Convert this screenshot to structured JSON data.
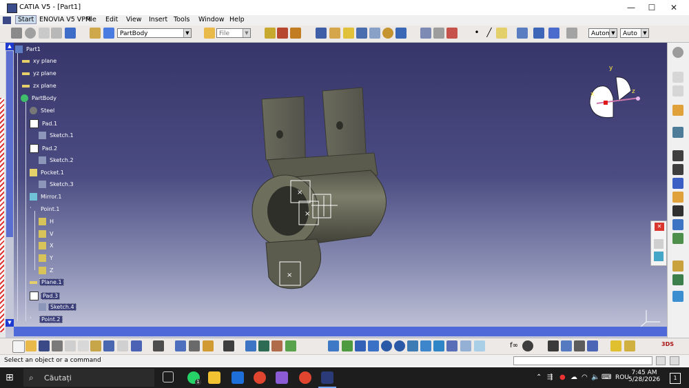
{
  "window": {
    "title": "CATIA V5 - [Part1]",
    "minimize": "—",
    "maximize": "☐",
    "close": "✕"
  },
  "menu": {
    "items": [
      "Start",
      "ENOVIA V5 VPM",
      "File",
      "Edit",
      "View",
      "Insert",
      "Tools",
      "Window",
      "Help"
    ]
  },
  "toolbar": {
    "body_select": "PartBody",
    "file_select": "File",
    "render_mode": "Autom",
    "auto_select": "Auto"
  },
  "tree": {
    "items": [
      {
        "label": "Part1",
        "icon": "part-icon",
        "selected": false
      },
      {
        "label": "xy plane",
        "icon": "plane-icon",
        "selected": false
      },
      {
        "label": "yz plane",
        "icon": "plane-icon",
        "selected": false
      },
      {
        "label": "zx plane",
        "icon": "plane-icon",
        "selected": false
      },
      {
        "label": "PartBody",
        "icon": "partbody-icon",
        "selected": false
      },
      {
        "label": "Steel",
        "icon": "material-icon",
        "selected": false
      },
      {
        "label": "Pad.1",
        "icon": "pad-icon",
        "selected": false
      },
      {
        "label": "Sketch.1",
        "icon": "sketch-icon",
        "selected": false
      },
      {
        "label": "Pad.2",
        "icon": "pad-icon",
        "selected": false
      },
      {
        "label": "Sketch.2",
        "icon": "sketch-icon",
        "selected": false
      },
      {
        "label": "Pocket.1",
        "icon": "pocket-icon",
        "selected": false
      },
      {
        "label": "Sketch.3",
        "icon": "sketch-icon",
        "selected": false
      },
      {
        "label": "Mirror.1",
        "icon": "mirror-icon",
        "selected": false
      },
      {
        "label": "Point.1",
        "icon": "point-icon",
        "selected": false
      },
      {
        "label": "H",
        "icon": "parameter-icon",
        "selected": false
      },
      {
        "label": "V",
        "icon": "parameter-icon",
        "selected": false
      },
      {
        "label": "X",
        "icon": "parameter-icon",
        "selected": false
      },
      {
        "label": "Y",
        "icon": "parameter-icon",
        "selected": false
      },
      {
        "label": "Z",
        "icon": "parameter-icon",
        "selected": false
      },
      {
        "label": "Plane.1",
        "icon": "plane-icon",
        "selected": true
      },
      {
        "label": "Pad.3",
        "icon": "pad-icon",
        "selected": true
      },
      {
        "label": "Sketch.4",
        "icon": "sketch-icon",
        "selected": true
      },
      {
        "label": "Point.2",
        "icon": "point-icon",
        "selected": true
      }
    ]
  },
  "compass": {
    "x": "x",
    "y": "y",
    "z": "z"
  },
  "status": {
    "message": "Select an object or a command"
  },
  "taskbar": {
    "search_placeholder": "Căutați",
    "lang": "ROU",
    "time": "7:45 AM",
    "date": "5/28/2026",
    "whatsapp_badge": "1",
    "notif_badge": "1"
  },
  "colors": {
    "viewport_top": "#37366b",
    "viewport_bottom": "#c7c9dc",
    "tree_scroll": "#4f6ad8",
    "part_metal": "#6c6c5a"
  }
}
